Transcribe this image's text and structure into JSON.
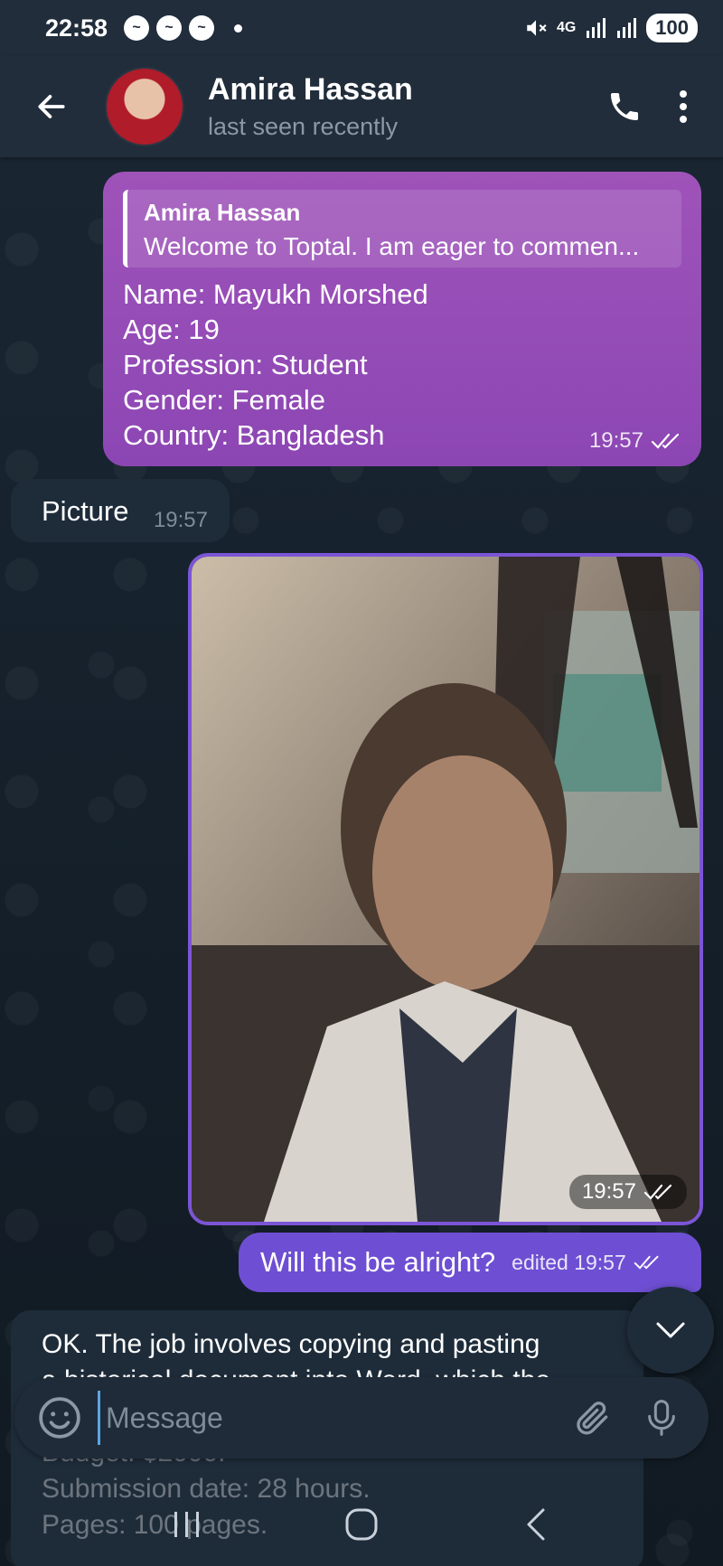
{
  "status_bar": {
    "time": "22:58",
    "network": "4G",
    "battery": "100",
    "icons": [
      "messenger-icon",
      "messenger-icon",
      "messenger-icon",
      "mute-icon",
      "signal-icon",
      "signal-icon"
    ]
  },
  "header": {
    "contact_name": "Amira Hassan",
    "status": "last seen recently"
  },
  "messages": {
    "info": {
      "reply_name": "Amira Hassan",
      "reply_text": "Welcome to Toptal. I am eager to commen...",
      "lines": [
        "Name: Mayukh Morshed",
        "Age: 19",
        "Profession: Student",
        "Gender: Female",
        "Country: Bangladesh"
      ],
      "time": "19:57"
    },
    "picture_label": {
      "text": "Picture",
      "time": "19:57"
    },
    "photo": {
      "time": "19:57"
    },
    "edited": {
      "text": "Will this be alright?",
      "meta": "edited 19:57"
    },
    "long": {
      "lines": [
        "OK. The job involves copying and pasting",
        "a historical document into Word, which the",
        "Budget: $2000.",
        "Submission date: 28 hours.",
        "Pages: 100 pages."
      ]
    }
  },
  "input": {
    "placeholder": "Message"
  },
  "colors": {
    "outgoing_bubble": "#9f53b9",
    "outgoing_edited": "#6e4fd3",
    "incoming_bubble": "#1e2c3a",
    "header_bg": "#212d3b",
    "accent": "#5aa7e6"
  }
}
